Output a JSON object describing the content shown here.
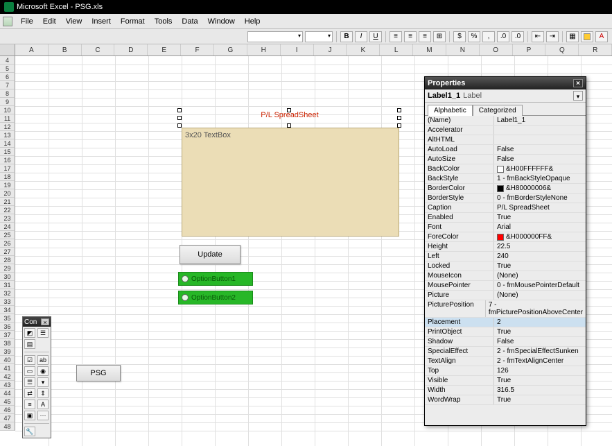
{
  "title": "Microsoft Excel - PSG.xls",
  "menus": [
    "File",
    "Edit",
    "View",
    "Insert",
    "Format",
    "Tools",
    "Data",
    "Window",
    "Help"
  ],
  "columns": [
    "A",
    "B",
    "C",
    "D",
    "E",
    "F",
    "G",
    "H",
    "I",
    "J",
    "K",
    "L",
    "M",
    "N",
    "O",
    "P",
    "Q",
    "R"
  ],
  "row_start": 4,
  "row_end": 48,
  "form": {
    "label_caption": "P/L SpreadSheet",
    "textbox_text": "3x20 TextBox",
    "update_label": "Update",
    "option1_label": "OptionButton1",
    "option2_label": "OptionButton2",
    "psg_label": "PSG"
  },
  "toolbox": {
    "title": "Con"
  },
  "properties": {
    "title": "Properties",
    "object_name": "Label1_1",
    "object_type": "Label",
    "tabs": {
      "alphabetic": "Alphabetic",
      "categorized": "Categorized",
      "active": "alphabetic"
    },
    "rows": [
      {
        "name": "(Name)",
        "value": "Label1_1"
      },
      {
        "name": "Accelerator",
        "value": ""
      },
      {
        "name": "AltHTML",
        "value": ""
      },
      {
        "name": "AutoLoad",
        "value": "False"
      },
      {
        "name": "AutoSize",
        "value": "False"
      },
      {
        "name": "BackColor",
        "value": "&H00FFFFFF&",
        "swatch": "#ffffff"
      },
      {
        "name": "BackStyle",
        "value": "1 - fmBackStyleOpaque"
      },
      {
        "name": "BorderColor",
        "value": "&H80000006&",
        "swatch": "#000000"
      },
      {
        "name": "BorderStyle",
        "value": "0 - fmBorderStyleNone"
      },
      {
        "name": "Caption",
        "value": "P/L SpreadSheet"
      },
      {
        "name": "Enabled",
        "value": "True"
      },
      {
        "name": "Font",
        "value": "Arial"
      },
      {
        "name": "ForeColor",
        "value": "&H000000FF&",
        "swatch": "#ff0000"
      },
      {
        "name": "Height",
        "value": "22.5"
      },
      {
        "name": "Left",
        "value": "240"
      },
      {
        "name": "Locked",
        "value": "True"
      },
      {
        "name": "MouseIcon",
        "value": "(None)"
      },
      {
        "name": "MousePointer",
        "value": "0 - fmMousePointerDefault"
      },
      {
        "name": "Picture",
        "value": "(None)"
      },
      {
        "name": "PicturePosition",
        "value": "7 - fmPicturePositionAboveCenter"
      },
      {
        "name": "Placement",
        "value": "2",
        "selected": true
      },
      {
        "name": "PrintObject",
        "value": "True"
      },
      {
        "name": "Shadow",
        "value": "False"
      },
      {
        "name": "SpecialEffect",
        "value": "2 - fmSpecialEffectSunken"
      },
      {
        "name": "TextAlign",
        "value": "2 - fmTextAlignCenter"
      },
      {
        "name": "Top",
        "value": "126"
      },
      {
        "name": "Visible",
        "value": "True"
      },
      {
        "name": "Width",
        "value": "316.5"
      },
      {
        "name": "WordWrap",
        "value": "True"
      }
    ]
  }
}
